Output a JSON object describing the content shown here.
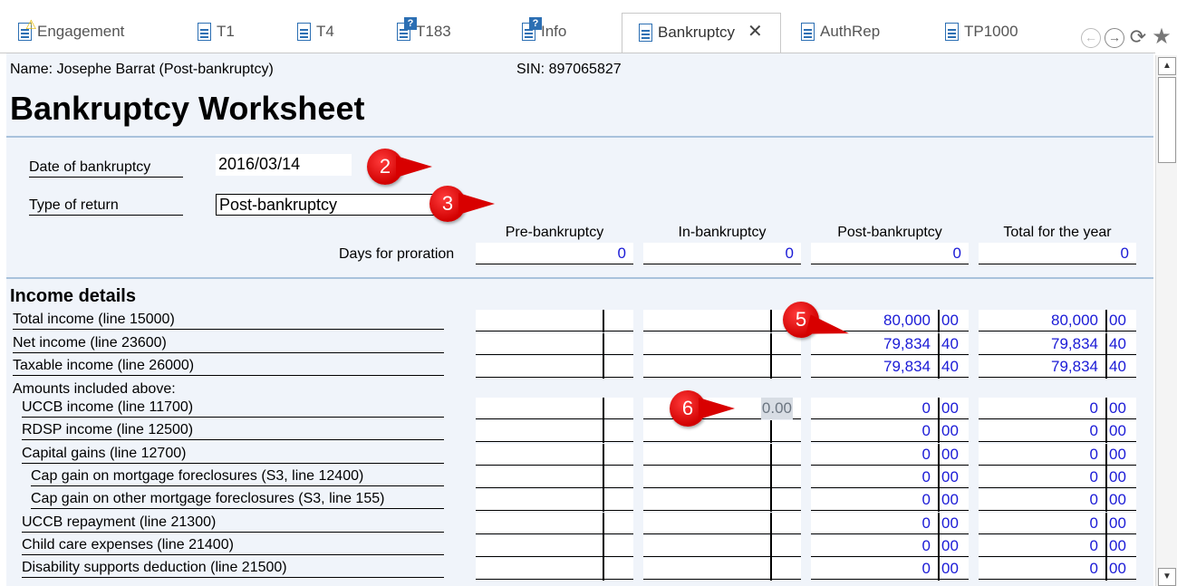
{
  "tabs": [
    {
      "label": "Engagement",
      "icon": "document-warning-icon"
    },
    {
      "label": "T1",
      "icon": "document-icon"
    },
    {
      "label": "T4",
      "icon": "document-icon"
    },
    {
      "label": "T183",
      "icon": "document-question-icon"
    },
    {
      "label": "Info",
      "icon": "document-question-icon"
    },
    {
      "label": "Bankruptcy",
      "icon": "document-icon",
      "active": true,
      "close": "✕"
    },
    {
      "label": "AuthRep",
      "icon": "document-icon"
    },
    {
      "label": "TP1000",
      "icon": "document-icon"
    }
  ],
  "nav": {
    "back": "←",
    "forward": "→",
    "refresh": "⟳",
    "favorite": "★"
  },
  "header": {
    "name": "Name:  Josephe Barrat (Post-bankruptcy)",
    "sin": "SIN:  897065827",
    "title": "Bankruptcy Worksheet"
  },
  "fields": {
    "date_label": "Date of bankruptcy",
    "date_value": "2016/03/14",
    "type_label": "Type of return",
    "type_value": "Post-bankruptcy"
  },
  "columns": [
    "Pre-bankruptcy",
    "In-bankruptcy",
    "Post-bankruptcy",
    "Total for the year"
  ],
  "proration": {
    "label": "Days for proration",
    "values": [
      "0",
      "0",
      "0",
      "0"
    ]
  },
  "income": {
    "title": "Income details",
    "rows": [
      {
        "label": "Total income (line 15000)",
        "post": [
          "80,000",
          "00"
        ],
        "total": [
          "80,000",
          "00"
        ]
      },
      {
        "label": "Net income (line 23600)",
        "post": [
          "79,834",
          "40"
        ],
        "total": [
          "79,834",
          "40"
        ]
      },
      {
        "label": "Taxable income (line 26000)",
        "post": [
          "79,834",
          "40"
        ],
        "total": [
          "79,834",
          "40"
        ]
      }
    ],
    "amounts_label": "Amounts included above:",
    "sub_rows": [
      {
        "label": "UCCB income (line 11700)",
        "in_editing": "0.00",
        "post": [
          "0",
          "00"
        ],
        "total": [
          "0",
          "00"
        ]
      },
      {
        "label": "RDSP income (line 12500)",
        "post": [
          "0",
          "00"
        ],
        "total": [
          "0",
          "00"
        ]
      },
      {
        "label": "Capital gains (line 12700)",
        "post": [
          "0",
          "00"
        ],
        "total": [
          "0",
          "00"
        ]
      },
      {
        "label": "Cap gain on mortgage foreclosures (S3, line 12400)",
        "post": [
          "0",
          "00"
        ],
        "total": [
          "0",
          "00"
        ]
      },
      {
        "label": "Cap gain on other mortgage foreclosures (S3, line 155)",
        "post": [
          "0",
          "00"
        ],
        "total": [
          "0",
          "00"
        ]
      },
      {
        "label": "UCCB repayment (line 21300)",
        "post": [
          "0",
          "00"
        ],
        "total": [
          "0",
          "00"
        ]
      },
      {
        "label": "Child care expenses (line 21400)",
        "post": [
          "0",
          "00"
        ],
        "total": [
          "0",
          "00"
        ]
      },
      {
        "label": "Disability supports deduction (line 21500)",
        "post": [
          "0",
          "00"
        ],
        "total": [
          "0",
          "00"
        ]
      }
    ]
  },
  "callouts": [
    "2",
    "3",
    "5",
    "6"
  ],
  "colors": {
    "value_blue": "#1a1ad6",
    "callout_red": "#d80000",
    "panel_bg": "#f0f4fa"
  },
  "scrollbar": {
    "up": "▲",
    "down": "▼"
  }
}
